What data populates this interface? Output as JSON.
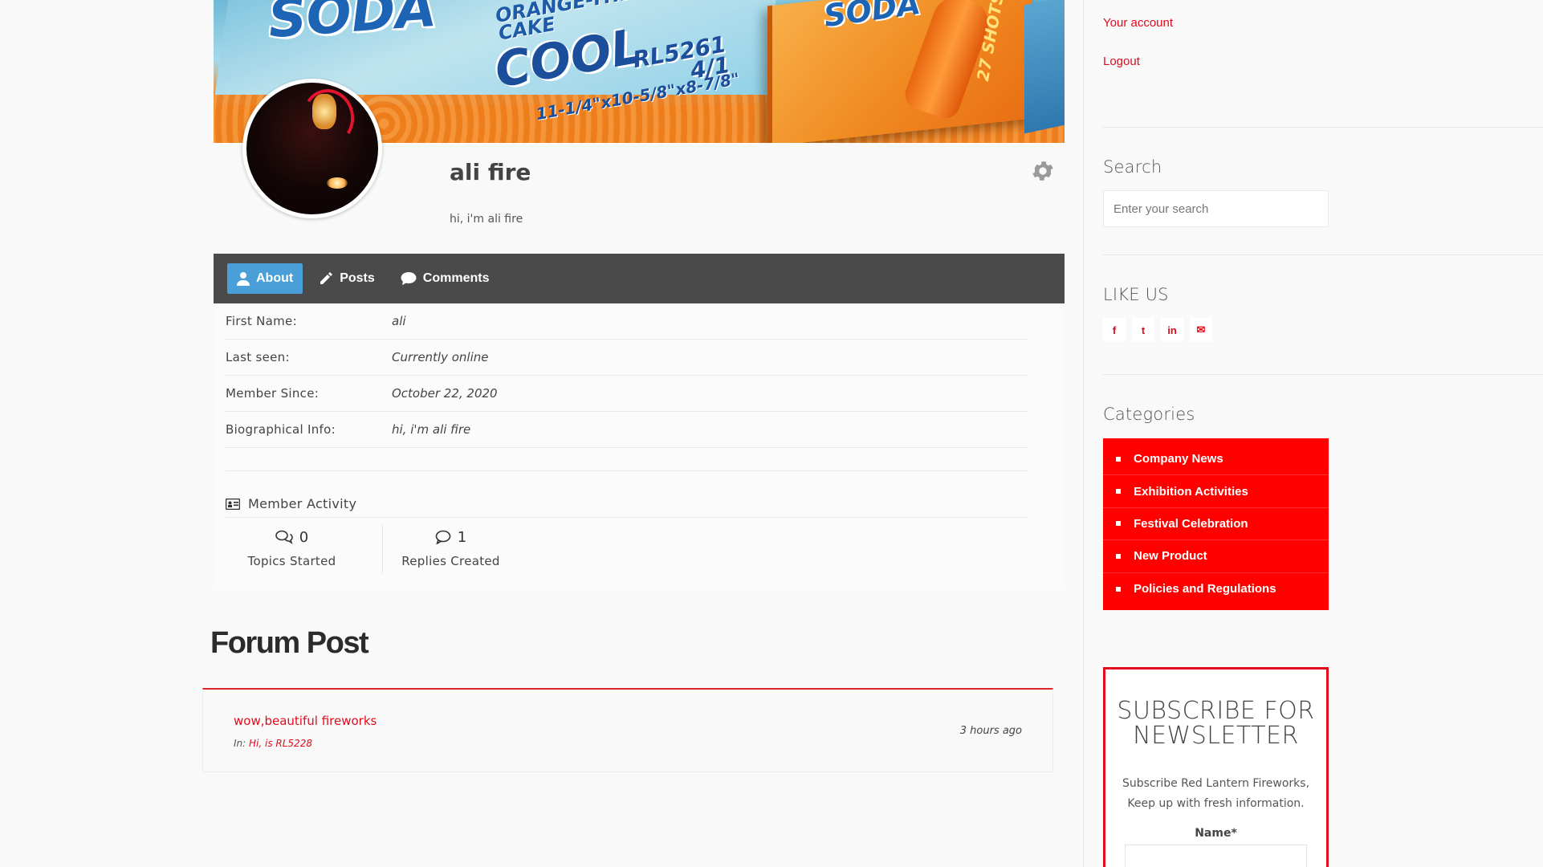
{
  "cover": {
    "text_soda": "SODA",
    "text_cake": "ORANGE-THE\nCAKE",
    "text_cool": "COOL",
    "text_code": "RL5261\n4/1",
    "text_dims": "11-1/4\"x10-5/8\"x8-7/8\"",
    "text_soda2": "SODA",
    "text_shots": "27 SHOTS"
  },
  "profile": {
    "name": "ali fire",
    "bio": "hi, i'm ali fire"
  },
  "tabs": [
    {
      "label": "About",
      "icon": "user-icon",
      "active": true
    },
    {
      "label": "Posts",
      "icon": "pencil-icon",
      "active": false
    },
    {
      "label": "Comments",
      "icon": "comment-icon",
      "active": false
    }
  ],
  "about": {
    "rows": [
      {
        "label": "First Name:",
        "value": "ali"
      },
      {
        "label": "Last seen:",
        "value": "Currently online"
      },
      {
        "label": "Member Since:",
        "value": "October 22, 2020"
      },
      {
        "label": "Biographical Info:",
        "value": "hi, i'm ali fire"
      }
    ],
    "activity_title": "Member Activity",
    "stats": [
      {
        "count": "0",
        "caption": "Topics Started",
        "icon": "topics-icon"
      },
      {
        "count": "1",
        "caption": "Replies Created",
        "icon": "reply-icon"
      }
    ]
  },
  "forum": {
    "title": "Forum Post",
    "post_title": "wow,beautiful fireworks",
    "in_label": "In:",
    "in_topic": "Hi, is RL5228",
    "time": "3 hours ago"
  },
  "sidebar": {
    "account_link": "Your account",
    "logout_link": "Logout",
    "search_title": "Search",
    "search_placeholder": "Enter your search",
    "like_title": "LIKE US",
    "social": [
      {
        "label": "f",
        "icon": "facebook-icon"
      },
      {
        "label": "t",
        "icon": "twitter-icon"
      },
      {
        "label": "in",
        "icon": "linkedin-icon"
      },
      {
        "label": "✉",
        "icon": "email-icon"
      }
    ],
    "categories_title": "Categories",
    "categories": [
      "Company News",
      "Exhibition Activities",
      "Festival Celebration",
      "New Product",
      "Policies and Regulations"
    ],
    "newsletter_title": "SUBSCRIBE FOR NEWSLETTER",
    "newsletter_text": "Subscribe Red Lantern Fireworks, Keep up with fresh information.",
    "newsletter_name_label": "Name*"
  },
  "colors": {
    "accent": "#e00b1c",
    "category_bg": "#ff0000",
    "tab_bar": "#4a4a4a",
    "tab_active": "#4a9fd8"
  }
}
